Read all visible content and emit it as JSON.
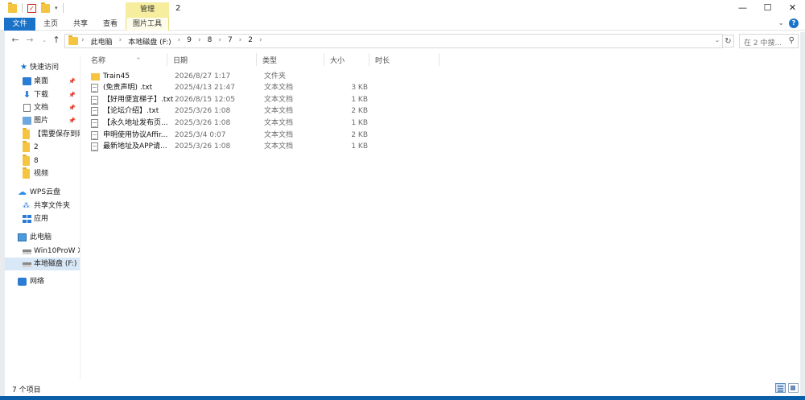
{
  "window": {
    "title": "2",
    "manage_tab": "管理",
    "controls": {
      "minimize": "—",
      "maximize": "☐",
      "close": "✕"
    }
  },
  "ribbon": {
    "file_tab": "文件",
    "tabs": [
      "主页",
      "共享",
      "查看"
    ],
    "picture_tools_tab": "图片工具",
    "help": "?",
    "expand": "⌄"
  },
  "address": {
    "crumbs": [
      "此电脑",
      "本地磁盘 (F:)",
      "9",
      "8",
      "7",
      "2"
    ],
    "search_placeholder": "在 2 中搜...",
    "nav": {
      "back": "←",
      "forward": "→",
      "recent": "⌄",
      "up": "↑"
    },
    "refresh": "↻",
    "dropdown": "⌄",
    "search_icon": "⚲"
  },
  "nav_pane": {
    "quick_access": "快速访问",
    "items": [
      {
        "label": "桌面",
        "pinned": true
      },
      {
        "label": "下载",
        "pinned": true
      },
      {
        "label": "文档",
        "pinned": true
      },
      {
        "label": "图片",
        "pinned": true
      },
      {
        "label": "【需要保存到网",
        "pinned": false
      },
      {
        "label": "2",
        "pinned": false
      },
      {
        "label": "8",
        "pinned": false
      },
      {
        "label": "视频",
        "pinned": false
      }
    ],
    "wps_cloud": "WPS云盘",
    "shared_folder": "共享文件夹",
    "apps": "应用",
    "this_pc": "此电脑",
    "drive1": "Win10ProW X",
    "drive2": "本地磁盘 (F:)",
    "network": "网络",
    "pin_glyph": "📌"
  },
  "columns": {
    "name": "名称",
    "date": "日期",
    "type": "类型",
    "size": "大小",
    "duration": "时长",
    "sort_glyph": "^"
  },
  "files": [
    {
      "name": "Train45",
      "date": "2026/8/27 1:17",
      "type": "文件夹",
      "size": "",
      "kind": "folder"
    },
    {
      "name": "(免责声明) .txt",
      "date": "2025/4/13 21:47",
      "type": "文本文档",
      "size": "3 KB",
      "kind": "txt"
    },
    {
      "name": "【好用便宜梯子】.txt",
      "date": "2026/8/15 12:05",
      "type": "文本文档",
      "size": "1 KB",
      "kind": "txt"
    },
    {
      "name": "【论坛介绍】.txt",
      "date": "2025/3/26 1:08",
      "type": "文本文档",
      "size": "2 KB",
      "kind": "txt"
    },
    {
      "name": "【永久地址发布页...",
      "date": "2025/3/26 1:08",
      "type": "文本文档",
      "size": "1 KB",
      "kind": "txt"
    },
    {
      "name": "申明使用协议Affir...",
      "date": "2025/3/4 0:07",
      "type": "文本文档",
      "size": "2 KB",
      "kind": "txt"
    },
    {
      "name": "最新地址及APP请...",
      "date": "2025/3/26 1:08",
      "type": "文本文档",
      "size": "1 KB",
      "kind": "txt"
    }
  ],
  "status": {
    "count": "7 个项目"
  },
  "colors": {
    "accent": "#1a73c9",
    "manage_tab": "#f6ed9e",
    "selection": "#d9e8f7",
    "folder": "#f5c542"
  }
}
